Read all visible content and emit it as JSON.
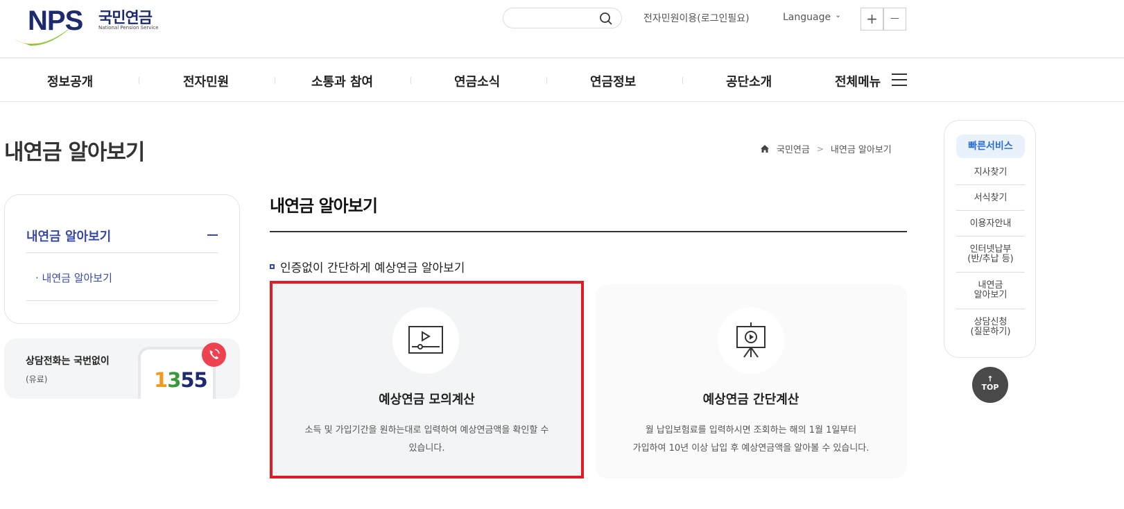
{
  "header": {
    "logo_text": "NPS",
    "logo_korean": "국민연금",
    "logo_english": "National Pension Service",
    "search_placeholder": "",
    "e_service_link": "전자민원이용(로그인필요)",
    "language_label": "Language",
    "zoom_in_label": "+",
    "zoom_out_label": "—"
  },
  "gnb": {
    "items": [
      "정보공개",
      "전자민원",
      "소통과 참여",
      "연금소식",
      "연금정보",
      "공단소개",
      "전체메뉴"
    ]
  },
  "page": {
    "title": "내연금 알아보기",
    "breadcrumb": [
      "국민연금",
      "내연금 알아보기"
    ]
  },
  "lnb": {
    "title": "내연금 알아보기",
    "sub_item": "· 내연금 알아보기"
  },
  "call_banner": {
    "title": "상담전화는 국번없이",
    "subtitle": "(유료)",
    "number": "1355"
  },
  "content": {
    "title": "내연금 알아보기",
    "section_heading": "인증없이 간단하게 예상연금 알아보기",
    "cards": [
      {
        "title": "예상연금 모의계산",
        "desc_line1": "소득 및 가입기간을 원하는대로 입력하여 예상연금액을 확인할 수",
        "desc_line2": "있습니다."
      },
      {
        "title": "예상연금 간단계산",
        "desc_line1": "월 납입보험료를 입력하시면 조회하는 해의 1월 1일부터",
        "desc_line2": "가입하여 10년 이상 납입 후 예상연금액을 알아볼 수 있습니다."
      }
    ]
  },
  "quick_menu": {
    "title": "빠른서비스",
    "items": [
      [
        "지사찾기"
      ],
      [
        "서식찾기"
      ],
      [
        "이용자안내"
      ],
      [
        "인터넷납부",
        "(반/추납 등)"
      ],
      [
        "내연금",
        "알아보기"
      ],
      [
        "상담신청",
        "(질문하기)"
      ]
    ],
    "top_label": "TOP"
  },
  "colors": {
    "brand_navy": "#1e2a6e",
    "lnb_blue": "#3848a7",
    "quick_blue": "#2b6fd6",
    "highlight_red": "#e01b24"
  }
}
